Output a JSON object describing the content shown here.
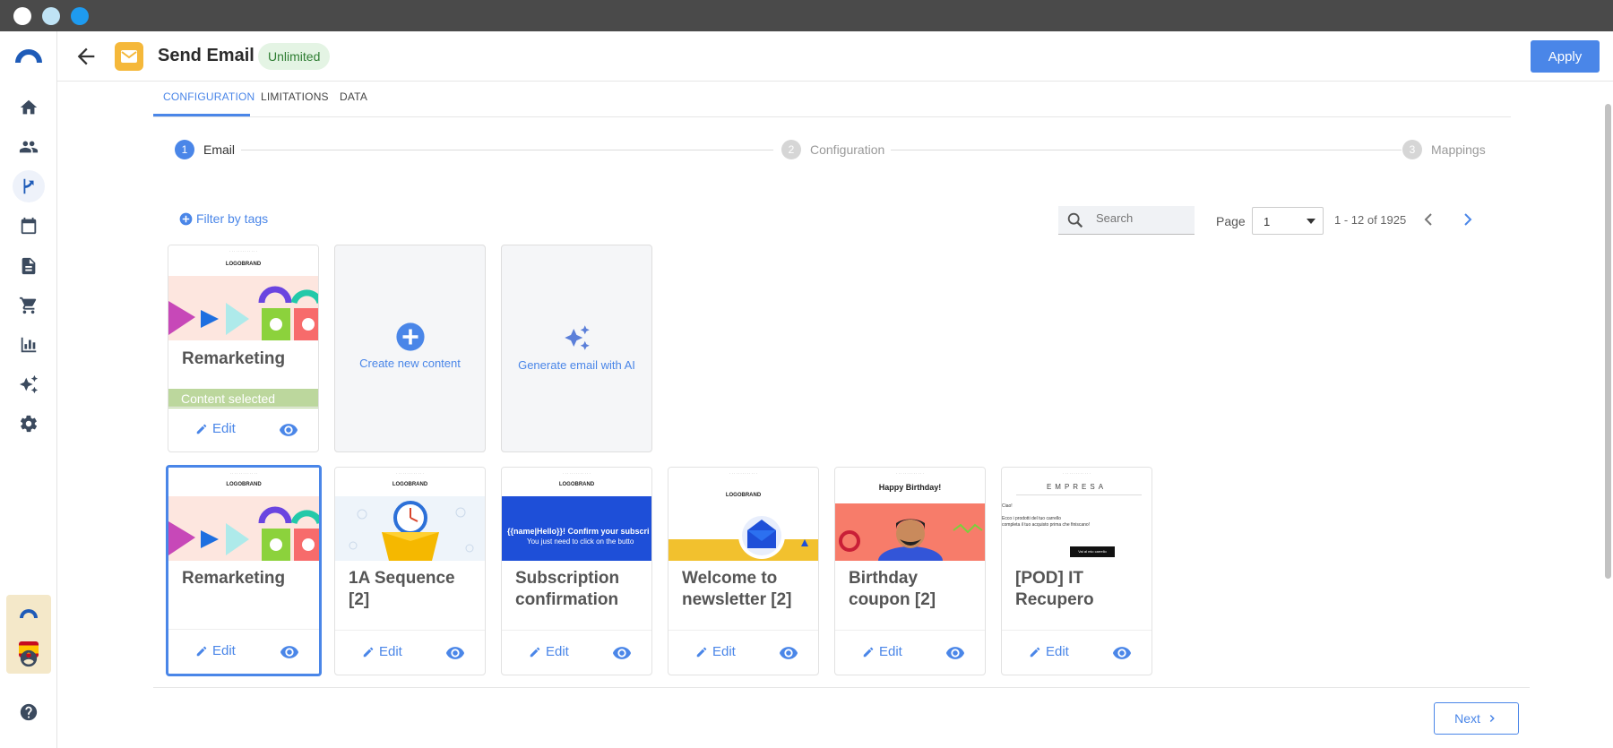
{
  "header": {
    "title": "Send Email",
    "badge": "Unlimited",
    "apply_label": "Apply"
  },
  "tabs": [
    {
      "label": "CONFIGURATION"
    },
    {
      "label": "LIMITATIONS"
    },
    {
      "label": "DATA"
    }
  ],
  "steps": [
    {
      "num": "1",
      "label": "Email"
    },
    {
      "num": "2",
      "label": "Configuration"
    },
    {
      "num": "3",
      "label": "Mappings"
    }
  ],
  "toolbar": {
    "filter_label": "Filter by tags",
    "search_placeholder": "Search",
    "page_label": "Page",
    "page_value": "1",
    "page_count": "1 - 12 of 1925"
  },
  "selected_card": {
    "title": "Remarketing",
    "status": "Content selected",
    "edit_label": "Edit"
  },
  "create_card": {
    "label": "Create new content"
  },
  "ai_card": {
    "label": "Generate email with AI"
  },
  "cards": [
    {
      "title": "Remarketing",
      "edit_label": "Edit"
    },
    {
      "title": "1A Sequence [2]",
      "edit_label": "Edit"
    },
    {
      "title": "Subscription confirmation",
      "edit_label": "Edit"
    },
    {
      "title": "Welcome to newsletter [2]",
      "edit_label": "Edit"
    },
    {
      "title": "Birthday coupon [2]",
      "edit_label": "Edit"
    },
    {
      "title": "[POD] IT Recupero",
      "edit_label": "Edit"
    }
  ],
  "thumb_text": {
    "logo": "LOGOBRAND",
    "subscription_line1": "{{name|Hello}}! Confirm your subscri",
    "subscription_line2": "You just need to click on the butto",
    "birthday": "Happy Birthday!",
    "empresa": "EMPRESA",
    "pod_line1": "Ciao!",
    "pod_line2": "Ecco i prodotti del tuo carrello",
    "pod_line3": "completa il tuo acquisto prima che finiscano!",
    "pod_button": "Vai al mio carrello"
  },
  "footer": {
    "next_label": "Next"
  },
  "colors": {
    "accent": "#4a86e8",
    "badge_bg": "#e4f4e4",
    "selected_bar": "#bcd79d",
    "titlebar": "#4a4a4a"
  },
  "icons": [
    "home-icon",
    "people-icon",
    "flow-icon",
    "calendar-icon",
    "document-icon",
    "cart-icon",
    "chart-icon",
    "sparkle-icon",
    "gear-icon",
    "user-icon",
    "help-icon"
  ]
}
